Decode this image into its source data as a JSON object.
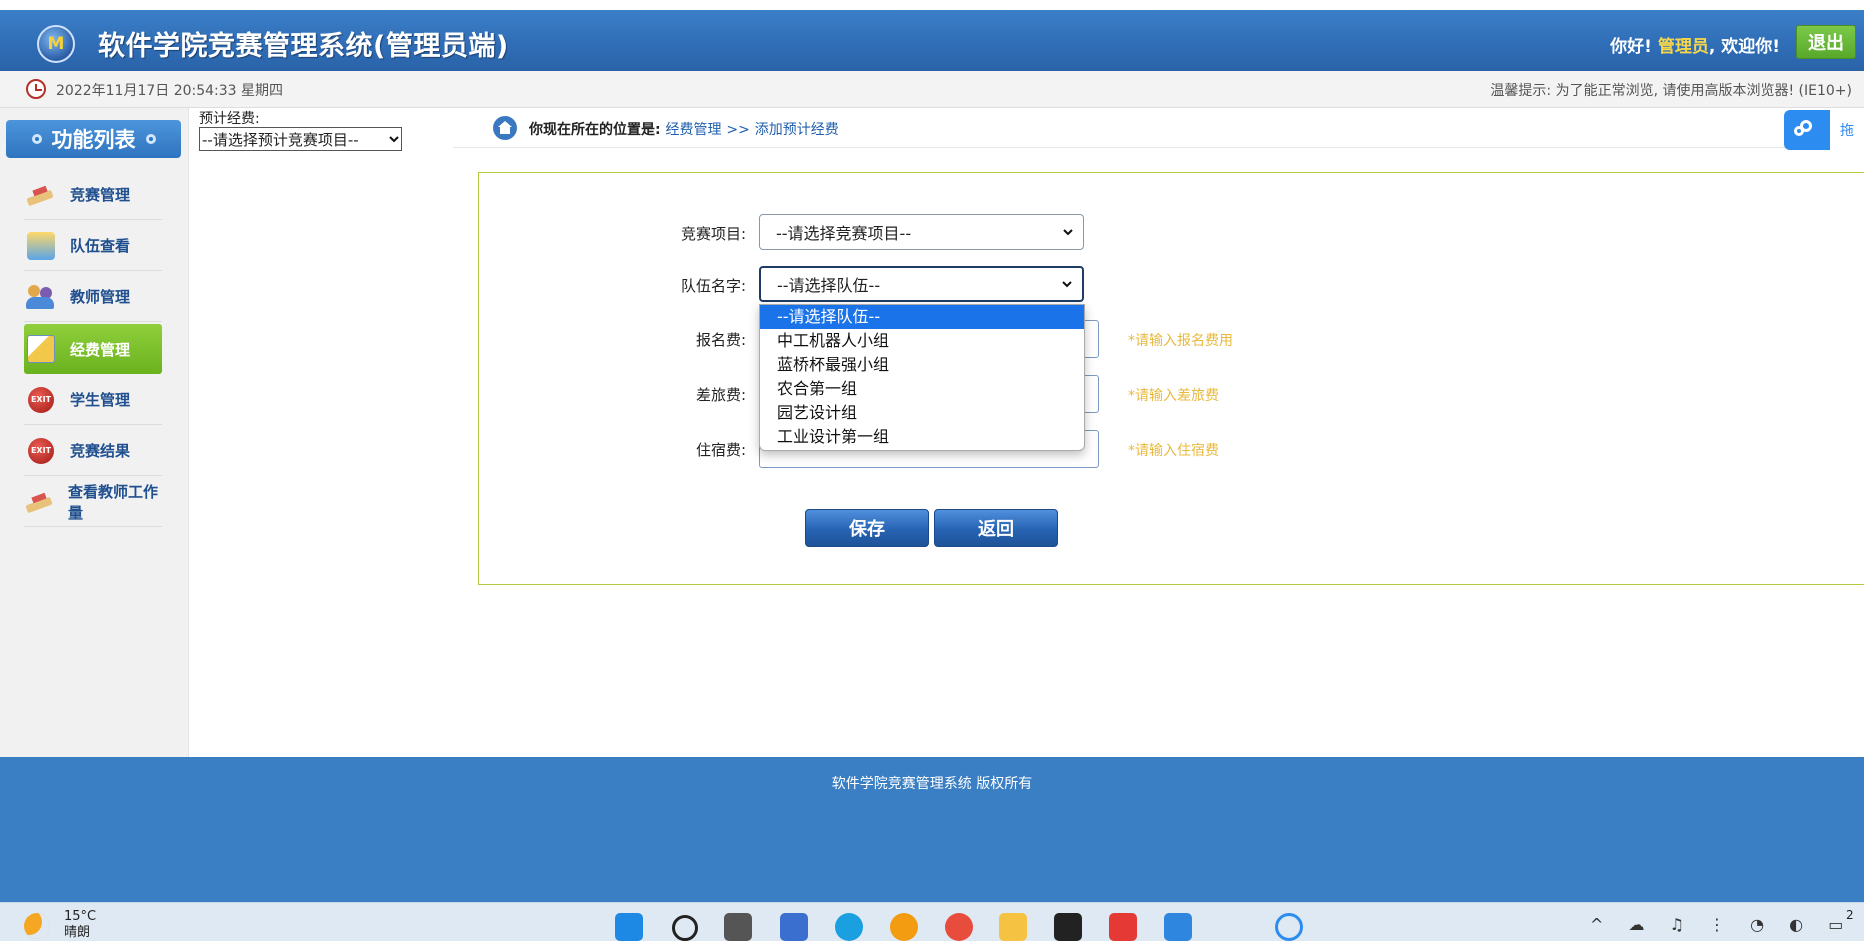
{
  "header": {
    "logo_text": "M",
    "title": "软件学院竞赛管理系统(管理员端)",
    "greeting_prefix": "你好!",
    "greeting_user": "管理员",
    "greeting_suffix": ", 欢迎你!",
    "logout_label": "退出"
  },
  "infobar": {
    "datetime": "2022年11月17日 20:54:33 星期四",
    "tip": "温馨提示: 为了能正常浏览, 请使用高版本浏览器! (IE10+)"
  },
  "sidebar": {
    "title": "功能列表",
    "items": [
      {
        "label": "竞赛管理",
        "icon": "pencil-icon"
      },
      {
        "label": "队伍查看",
        "icon": "team-icon"
      },
      {
        "label": "教师管理",
        "icon": "people-icon"
      },
      {
        "label": "经费管理",
        "icon": "money-icon",
        "active": true
      },
      {
        "label": "学生管理",
        "icon": "exit-icon"
      },
      {
        "label": "竞赛结果",
        "icon": "exit-icon"
      },
      {
        "label": "查看教师工作量",
        "icon": "pencil-icon"
      }
    ]
  },
  "budget": {
    "label": "预计经费:",
    "select_value": "--请选择预计竞赛项目--"
  },
  "breadcrumb": {
    "prefix": "你现在所在的位置是:",
    "level1": "经费管理",
    "separator": ">>",
    "level2": "添加预计经费"
  },
  "float_button": {
    "text": "拖"
  },
  "form": {
    "competition_label": "竞赛项目:",
    "competition_value": "--请选择竞赛项目--",
    "team_label": "队伍名字:",
    "team_value": "--请选择队伍--",
    "signup_label": "报名费:",
    "signup_hint": "*请输入报名费用",
    "travel_label": "差旅费:",
    "travel_hint": "*请输入差旅费",
    "lodging_label": "住宿费:",
    "lodging_hint": "*请输入住宿费",
    "save_label": "保存",
    "back_label": "返回"
  },
  "team_dropdown": {
    "options": [
      "--请选择队伍--",
      "中工机器人小组",
      "蓝桥杯最强小组",
      "农合第一组",
      "园艺设计组",
      "工业设计第一组"
    ],
    "selected_index": 0
  },
  "footer": {
    "text": "软件学院竞赛管理系统 版权所有"
  },
  "taskbar": {
    "temperature": "15°C",
    "weather": "晴朗",
    "time_fragment": "2"
  },
  "colors": {
    "header_blue": "#2f6db6",
    "accent_green": "#6bb21f",
    "hint_yellow": "#e8b93e",
    "selected_blue": "#1a73e8"
  }
}
